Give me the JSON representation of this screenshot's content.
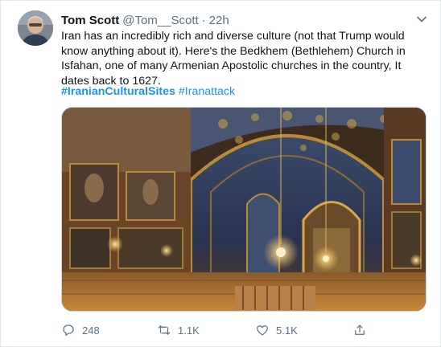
{
  "tweet": {
    "author_name": "Tom Scott",
    "handle": "@Tom__Scott",
    "separator": "·",
    "time": "22h",
    "text": "Iran has an incredibly rich and diverse culture (not that Trump would know anything about it). Here's the Bedkhem (Bethlehem) Church in Isfahan, one of many Armenian Apostolic churches in the country, It dates back to 1627.",
    "hashtags": [
      "#IranianCulturalSites",
      "#Iranattack"
    ]
  },
  "actions": {
    "reply_count": "248",
    "retweet_count": "1.1K",
    "like_count": "5.1K"
  },
  "icons": {
    "more": "chevron-down-icon",
    "reply": "reply-icon",
    "retweet": "retweet-icon",
    "like": "heart-icon",
    "share": "share-icon"
  },
  "colors": {
    "accent": "#1b95e0",
    "secondary_text": "#5b7083",
    "primary_text": "#0f1419"
  }
}
